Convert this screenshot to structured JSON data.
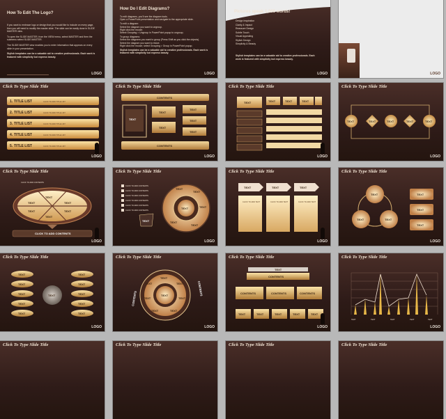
{
  "common": {
    "slide_title": "Click To Type Slide Title",
    "logo": "LOGO",
    "text": "TEXT",
    "contents": "CONTENTS",
    "click_add": "CLICK TO ADD CONTENTS",
    "click_add_title": "CLICK TO ADD TITLE",
    "click_add_text": "CLICK TO ADD TEXT",
    "click_add_text_lc": "Click to add text",
    "title_list": "TITLE LIST",
    "click_add_title_list": "CLICK TO ADD TITLE LIST"
  },
  "slide1": {
    "title": "How To Edit The Logo?",
    "bullets": [
      "If you want to embrace logo or design that you would like to include on every page, then you will need to modify the master slide. The slide can be easily done in SLIDE MASTER view.",
      "To open the SLIDE MASTER, from the VIEW menu, select MASTER and then the submenu select SLIDE MASTER.",
      "The SLIDE MASTER view enables you to enter information that appears on every slide in your presentation.",
      "Stylish templates can be a valuable aid to creative professionals. Each work is featured with simplicity but express beauty."
    ]
  },
  "slide2": {
    "title": "How Do I Edit Diagrams?",
    "bullets": [
      "To edit diagrams, you'll see the diagram tools.",
      "Open a PowerPoint presentation and navigate to the appropriate slide.",
      "To edit a diagram:",
      "Select the diagram you want to ungroup.",
      "Right click the mouse.",
      "Select Grouping > Ungroup in PowerPoint popup to ungroup.",
      "To group diagrams:",
      "Select the diagrams you want to group (Press Shift as you click the objects).",
      "Select the diagram you want to resize.",
      "Right click the mouse; select Grouping > Group in PowerPoint popup.",
      "Stylish templates can be a valuable aid to creative professionals. Each work is featured with simplicity but express beauty."
    ]
  },
  "slide3": {
    "title": "Pictures speak 1,000 words!",
    "bullets": [
      "Design Inspiration",
      "Clarity & Impact",
      "Reassure Design",
      "Subtle Touch",
      "Visual Appealing",
      "Stylish Design",
      "Simplicity & Beauty"
    ],
    "quote": "Stylish templates can be a valuable aid to creative professionals. Each work is featured with simplicity but express beauty."
  }
}
